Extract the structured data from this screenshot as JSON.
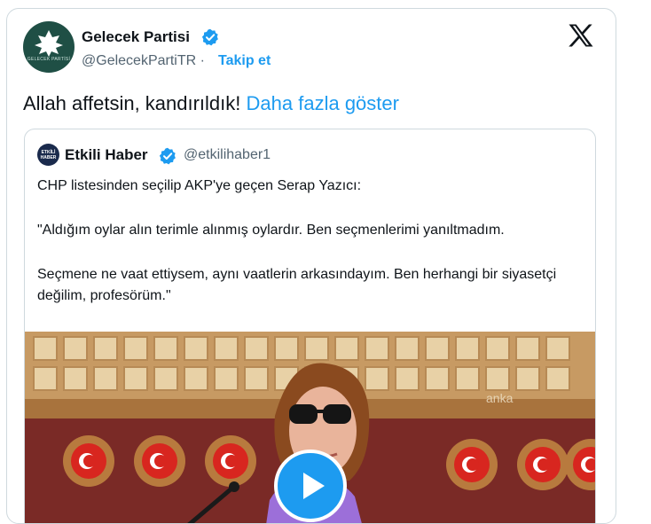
{
  "account": {
    "name": "Gelecek Partisi",
    "handle": "@GelecekPartiTR",
    "separator": "·",
    "follow_label": "Takip et",
    "avatar_caption": "GELECEK PARTİSİ"
  },
  "tweet": {
    "text": "Allah affetsin, kandırıldık!",
    "more_label": "Daha fazla göster"
  },
  "quoted": {
    "name": "Etkili Haber",
    "handle": "@etkilihaber1",
    "avatar_label": "ETKİLİ HABER",
    "paragraphs": [
      "CHP listesinden seçilip AKP'ye geçen Serap Yazıcı:",
      "\"Aldığım oylar alın terimle alınmış oylardır. Ben seçmenlerimi yanıltmadım.",
      "Seçmene ne vaat ettiysem, aynı vaatlerin arkasındayım. Ben herhangi bir siyasetçi değilim, profesörüm.\""
    ],
    "watermark": "anka"
  },
  "colors": {
    "accent": "#1d9bf0",
    "verified": "#1d9bf0",
    "text": "#0f1419",
    "secondary": "#536471",
    "border": "#cfd9de",
    "avatar_bg": "#1f4f45"
  },
  "icons": {
    "platform": "x-logo-icon",
    "verified": "verified-badge-icon",
    "play": "play-icon"
  }
}
